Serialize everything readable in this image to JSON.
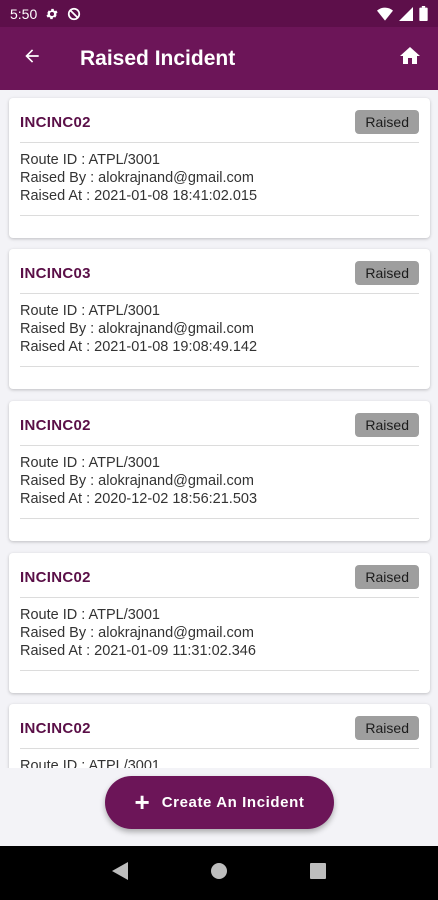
{
  "status_bar": {
    "time": "5:50"
  },
  "app_bar": {
    "title": "Raised Incident"
  },
  "incidents": [
    {
      "code": "INCINC02",
      "status": "Raised",
      "route": "Route ID : ATPL/3001",
      "raised_by": "Raised By : alokrajnand@gmail.com",
      "raised_at": "Raised At : 2021-01-08 18:41:02.015"
    },
    {
      "code": "INCINC03",
      "status": "Raised",
      "route": "Route ID : ATPL/3001",
      "raised_by": "Raised By : alokrajnand@gmail.com",
      "raised_at": "Raised At : 2021-01-08 19:08:49.142"
    },
    {
      "code": "INCINC02",
      "status": "Raised",
      "route": "Route ID : ATPL/3001",
      "raised_by": "Raised By : alokrajnand@gmail.com",
      "raised_at": "Raised At : 2020-12-02 18:56:21.503"
    },
    {
      "code": "INCINC02",
      "status": "Raised",
      "route": "Route ID : ATPL/3001",
      "raised_by": "Raised By : alokrajnand@gmail.com",
      "raised_at": "Raised At : 2021-01-09 11:31:02.346"
    },
    {
      "code": "INCINC02",
      "status": "Raised",
      "route": "Route ID : ATPL/3001",
      "raised_by": "",
      "raised_at": ""
    }
  ],
  "fab": {
    "label": "Create An Incident"
  },
  "colors": {
    "primary": "#6c1558",
    "status_bar": "#5d0f4a",
    "incident_code": "#5a0f47",
    "badge": "#9e9e9e"
  },
  "icons": {
    "status": [
      "gear-icon",
      "no-disturb-icon",
      "wifi-icon",
      "signal-icon",
      "battery-icon"
    ],
    "app_bar": [
      "back-arrow-icon",
      "home-icon"
    ],
    "nav": [
      "nav-back-icon",
      "nav-home-icon",
      "nav-recents-icon"
    ]
  }
}
